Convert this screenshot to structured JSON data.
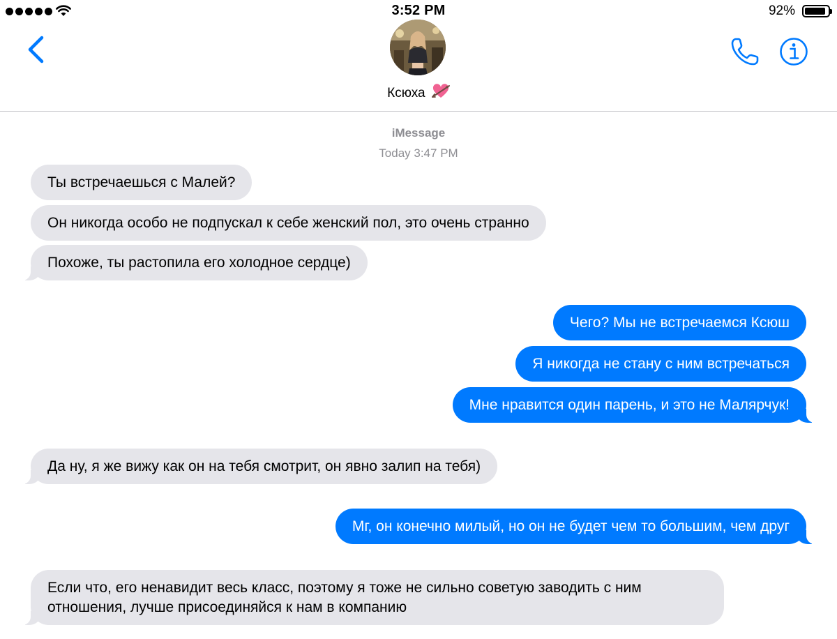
{
  "status_bar": {
    "time": "3:52 PM",
    "battery": "92%",
    "battery_level": 0.92,
    "signal_dots": 5
  },
  "header": {
    "contact_name": "Ксюха",
    "contact_emoji": "heart-with-arrow",
    "accent_color": "#007aff",
    "icons": [
      "back-chevron-icon",
      "phone-icon",
      "info-icon"
    ]
  },
  "conversation": {
    "service": "iMessage",
    "timestamp": "Today 3:47 PM",
    "messages": [
      {
        "direction": "in",
        "text": "Ты встречаешься с Малей?"
      },
      {
        "direction": "in",
        "text": "Он никогда особо не подпускал к себе женский пол, это очень странно"
      },
      {
        "direction": "in",
        "text": "Похоже, ты растопила его холодное сердце)"
      },
      {
        "direction": "out",
        "text": "Чего? Мы не встречаемся Ксюш"
      },
      {
        "direction": "out",
        "text": "Я никогда не стану с ним встречаться"
      },
      {
        "direction": "out",
        "text": "Мне нравится один парень, и это не Малярчук!"
      },
      {
        "direction": "in",
        "text": "Да ну, я же вижу как он на тебя смотрит, он явно залип на тебя)"
      },
      {
        "direction": "out",
        "text": "Мг, он конечно милый, но он не будет чем то большим, чем друг"
      },
      {
        "direction": "in",
        "text": "Если что, его ненавидит весь класс, поэтому я тоже не сильно советую заводить с ним отношения, лучше присоединяйся к нам в компанию"
      }
    ],
    "incoming_bubble_color": "#e5e5ea",
    "outgoing_bubble_color": "#007aff"
  }
}
